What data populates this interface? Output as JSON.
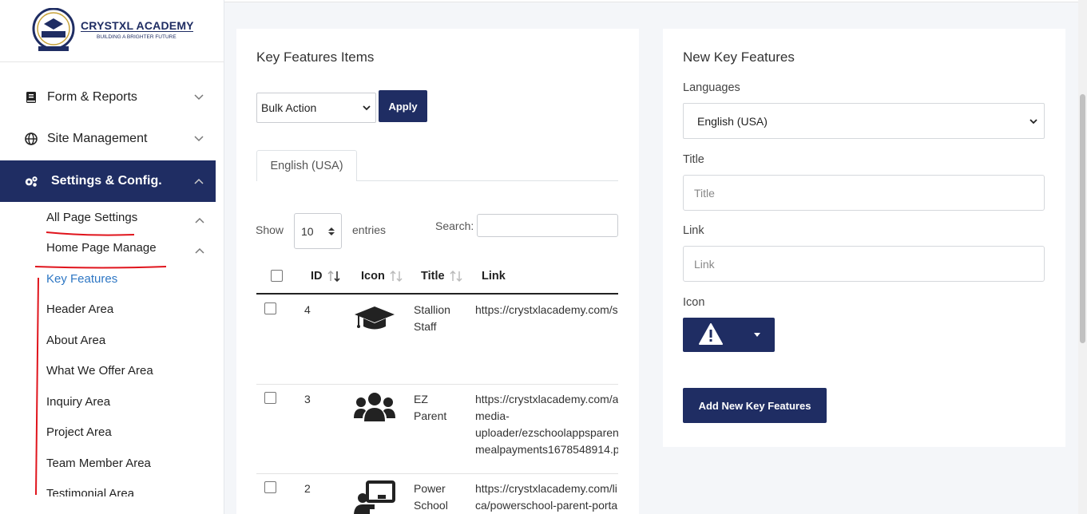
{
  "brand": {
    "name": "CRYSTXL ACADEMY",
    "tagline": "BUILDING A BRIGHTER FUTURE",
    "seal_text": "CRYSTXL"
  },
  "sidebar": {
    "menu": [
      {
        "label": "Form & Reports",
        "icon": "book-icon"
      },
      {
        "label": "Site Management",
        "icon": "globe-icon"
      },
      {
        "label": "Settings & Config.",
        "icon": "gears-icon"
      }
    ],
    "sub_menu": [
      {
        "label": "All Page Settings"
      },
      {
        "label": "Home Page Manage"
      }
    ],
    "leaves": [
      {
        "label": "Key Features"
      },
      {
        "label": "Header Area"
      },
      {
        "label": "About Area"
      },
      {
        "label": "What We Offer Area"
      },
      {
        "label": "Inquiry Area"
      },
      {
        "label": "Project Area"
      },
      {
        "label": "Team Member Area"
      },
      {
        "label": "Testimonial Area"
      }
    ]
  },
  "list_card": {
    "title": "Key Features Items",
    "bulk_action": "Bulk Action",
    "apply_label": "Apply",
    "tab_label": "English (USA)",
    "show_label": "Show",
    "entries_value": "10",
    "entries_label": "entries",
    "search_label": "Search:",
    "columns": {
      "id": "ID",
      "icon": "Icon",
      "title": "Title",
      "link": "Link"
    },
    "rows": [
      {
        "id": "4",
        "icon": "graduation-cap-icon",
        "title_1": "Stallion",
        "title_2": "Staff",
        "link_1": "https://crystxlacademy.com/s",
        "link_2": "",
        "link_3": "",
        "link_4": ""
      },
      {
        "id": "3",
        "icon": "users-icon",
        "title_1": "EZ",
        "title_2": "Parent",
        "link_1": "https://crystxlacademy.com/a",
        "link_2": "media-",
        "link_3": "uploader/ezschoolappsparent",
        "link_4": "mealpayments1678548914.p"
      },
      {
        "id": "2",
        "icon": "chalkboard-teacher-icon",
        "title_1": "Power",
        "title_2": "School",
        "link_1": "https://crystxlacademy.com/li",
        "link_2": "ca/powerschool-parent-porta",
        "link_3": "",
        "link_4": ""
      }
    ]
  },
  "form_card": {
    "title": "New Key Features",
    "languages_label": "Languages",
    "language_value": "English (USA)",
    "title_label": "Title",
    "title_placeholder": "Title",
    "link_label": "Link",
    "link_placeholder": "Link",
    "icon_label": "Icon",
    "icon_value": "exclamation-triangle-icon",
    "submit_label": "Add New Key Features"
  },
  "colors": {
    "primary": "#1f2d63",
    "active_link": "#2e77c4",
    "annotation": "#e0141c"
  }
}
